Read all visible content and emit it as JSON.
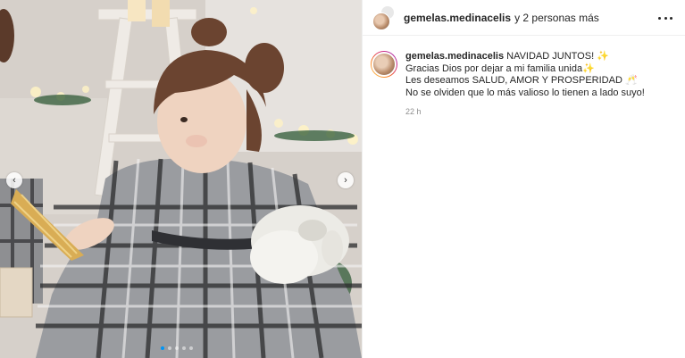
{
  "post": {
    "header": {
      "username": "gemelas.medinacelis",
      "others": "y 2 personas más"
    },
    "caption": {
      "username": "gemelas.medinacelis",
      "lines": [
        "NAVIDAD JUNTOS! ✨",
        "Gracias Dios por dejar a mi familia unida✨",
        "Les deseamos SALUD, AMOR Y PROSPERIDAD 🥂",
        "No se olviden que lo más valioso lo tienen a lado suyo!"
      ]
    },
    "timestamp": "22 h"
  },
  "carousel": {
    "slide_count": 5,
    "active_index": 0
  },
  "colors": {
    "accent": "#0095f6",
    "text": "#262626",
    "muted": "#8e8e8e",
    "divider": "#efefef"
  },
  "icons": {
    "prev": "chevron-left-icon",
    "next": "chevron-right-icon",
    "more": "more-options-icon"
  }
}
